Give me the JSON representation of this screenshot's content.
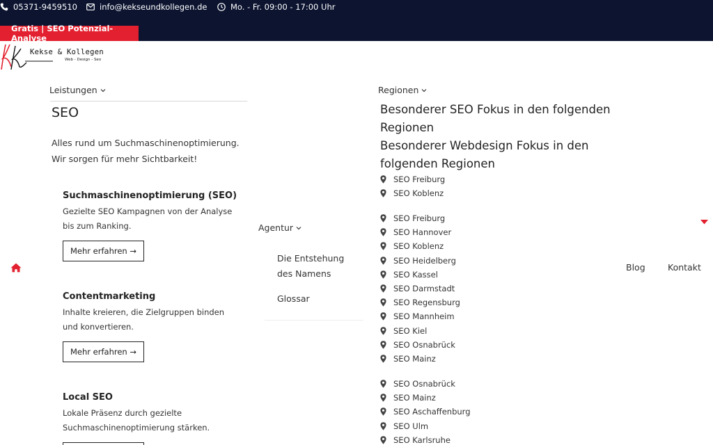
{
  "topbar": {
    "phone": "05371-9459510",
    "email": "info@kekseundkollegen.de",
    "hours": "Mo. - Fr. 09:00 - 17:00 Uhr",
    "promo": "Gratis | SEO Potenzial-Analyse"
  },
  "logo": {
    "brand": "Kekse & Kollegen",
    "tagline": "Web - Design - Seo"
  },
  "colors": {
    "topbar_bg": "#0c1430",
    "accent_red": "#e3202f"
  },
  "nav": {
    "leistungen": "Leistungen",
    "agentur": "Agentur",
    "regionen": "Regionen",
    "blog": "Blog",
    "kontakt": "Kontakt"
  },
  "leistungen": {
    "title": "SEO",
    "description": "Alles rund um Suchmaschinenoptimierung. Wir sorgen für mehr Sichtbarkeit!",
    "services": [
      {
        "title": "Suchmaschinenoptimierung (SEO)",
        "text": "Gezielte SEO Kampagnen von der Analyse bis zum Ranking.",
        "button": "Mehr erfahren →"
      },
      {
        "title": "Contentmarketing",
        "text": "Inhalte kreieren, die Zielgruppen binden und konvertieren.",
        "button": "Mehr erfahren →"
      },
      {
        "title": "Local SEO",
        "text": "Lokale Präsenz durch gezielte Suchmaschinenoptimierung stärken."
      }
    ]
  },
  "agentur": {
    "items": [
      "Die Entstehung des Namens",
      "Glossar"
    ]
  },
  "regionen": {
    "heading_seo": "Besonderer SEO Fokus in den folgenden Regionen",
    "heading_webdesign": "Besonderer Webdesign Fokus in den folgenden Regionen",
    "group1": [
      "SEO Freiburg",
      "SEO Koblenz"
    ],
    "group2": [
      "SEO Freiburg",
      "SEO Hannover",
      "SEO Koblenz",
      "SEO Heidelberg",
      "SEO Kassel",
      "SEO Darmstadt",
      "SEO Regensburg",
      "SEO Mannheim",
      "SEO Kiel",
      "SEO Osnabrück",
      "SEO Mainz"
    ],
    "group3": [
      "SEO Osnabrück",
      "SEO Mainz",
      "SEO Aschaffenburg",
      "SEO Ulm",
      "SEO Karlsruhe"
    ]
  }
}
